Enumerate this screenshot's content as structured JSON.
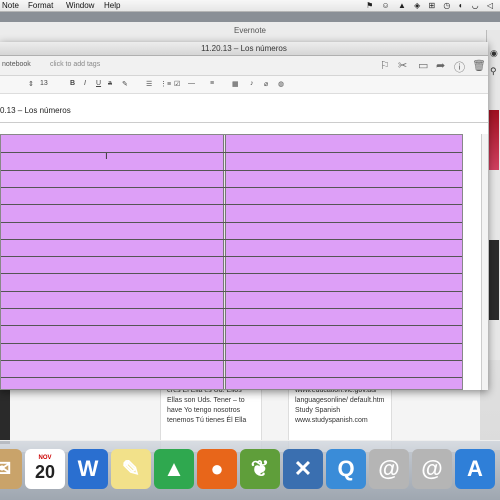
{
  "menubar": {
    "items": [
      "Note",
      "Format",
      "Window",
      "Help"
    ],
    "status": "⚑ ☺ ▲ ◈ ⊞ ◷ ◐ ◡ ◁"
  },
  "background_window": {
    "title": "Evernote",
    "col1_text": "eres Él Ella es Ud. Ellos Ellas son Uds. Tener – to have Yo tengo nosotros tenemos Tú tienes Él Ella",
    "col2_text": "www.education.vic.gov.au/ languagesonline/ default.htm Study Spanish www.studyspanish.com"
  },
  "note_window": {
    "title": "11.20.13 – Los números",
    "notebook_label": "notebook",
    "tags_placeholder": "click to add tags",
    "font_size": "13",
    "heading": "0.13 – Los números"
  },
  "toolbar": {
    "size_stepper": "⇕",
    "bold": "B",
    "italic": "I",
    "underline": "U",
    "strike": "a",
    "align": "≡",
    "bullets": "☰",
    "numbers": "⋮≡",
    "checkbox": "☑",
    "hr": "—",
    "indent": "≡·",
    "table": "▦",
    "mic": "♪",
    "attach": "⌀",
    "link": "◍"
  },
  "table": {
    "rows": 13,
    "columns": 2,
    "fill_color": "#dd9ff7"
  },
  "dock": {
    "items": [
      {
        "icon": "mail-icon",
        "glyph": "✉"
      },
      {
        "icon": "calendar-icon",
        "month": "NOV",
        "day": "20"
      },
      {
        "icon": "word-icon",
        "glyph": "W"
      },
      {
        "icon": "stickies-icon",
        "glyph": "✎"
      },
      {
        "icon": "google-drive-icon",
        "glyph": "▲"
      },
      {
        "icon": "firefox-icon",
        "glyph": "●"
      },
      {
        "icon": "evernote-icon",
        "glyph": "❦"
      },
      {
        "icon": "xcode-icon",
        "glyph": "✕"
      },
      {
        "icon": "quicktime-icon",
        "glyph": "Q"
      },
      {
        "icon": "at-icon",
        "glyph": "@"
      },
      {
        "icon": "at-icon-2",
        "glyph": "@"
      },
      {
        "icon": "appstore-icon",
        "glyph": "A"
      }
    ]
  }
}
